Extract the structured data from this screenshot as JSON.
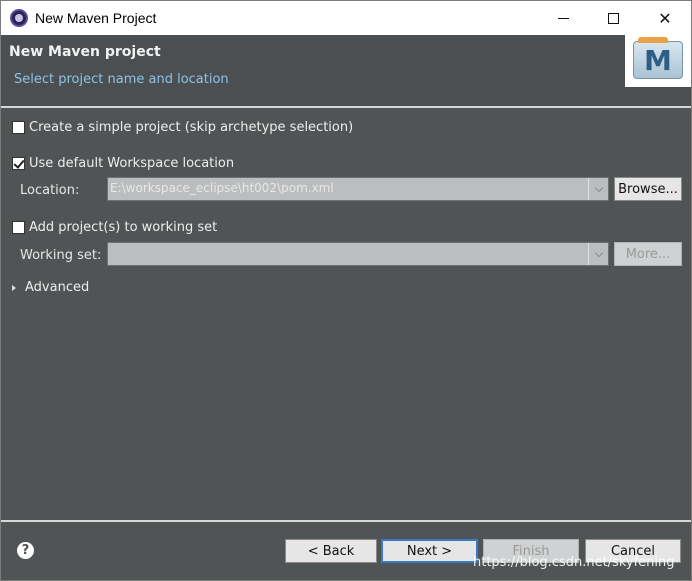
{
  "window": {
    "title": "New Maven Project",
    "controls": {
      "minimize": "minimize",
      "maximize": "maximize",
      "close": "✕"
    }
  },
  "header": {
    "title": "New Maven project",
    "subtitle": "Select project name and location",
    "logo_letter": "M"
  },
  "options": {
    "simple_project": {
      "label": "Create a simple project (skip archetype selection)",
      "checked": false
    },
    "default_workspace": {
      "label": "Use default Workspace location",
      "checked": true
    },
    "location": {
      "label": "Location:",
      "value": "E:\\workspace_eclipse\\ht002\\pom.xml",
      "browse_label": "Browse..."
    },
    "working_set_toggle": {
      "label": "Add project(s) to working set",
      "checked": false
    },
    "working_set": {
      "label": "Working set:",
      "value": "",
      "more_label": "More..."
    },
    "advanced": {
      "label": "Advanced"
    }
  },
  "footer": {
    "help": "?",
    "back_label": "< Back",
    "next_label": "Next >",
    "finish_label": "Finish",
    "cancel_label": "Cancel",
    "watermark": "https://blog.csdn.net/skyfening"
  },
  "colors": {
    "body_bg": "#505455",
    "header_bg": "#4b4f51",
    "subtitle": "#8fc3e6",
    "accent": "#3a78c9"
  },
  "icons": {
    "app": "eclipse-icon",
    "logo": "maven-logo-icon",
    "help": "help-icon",
    "advanced": "disclosure-triangle-icon"
  }
}
